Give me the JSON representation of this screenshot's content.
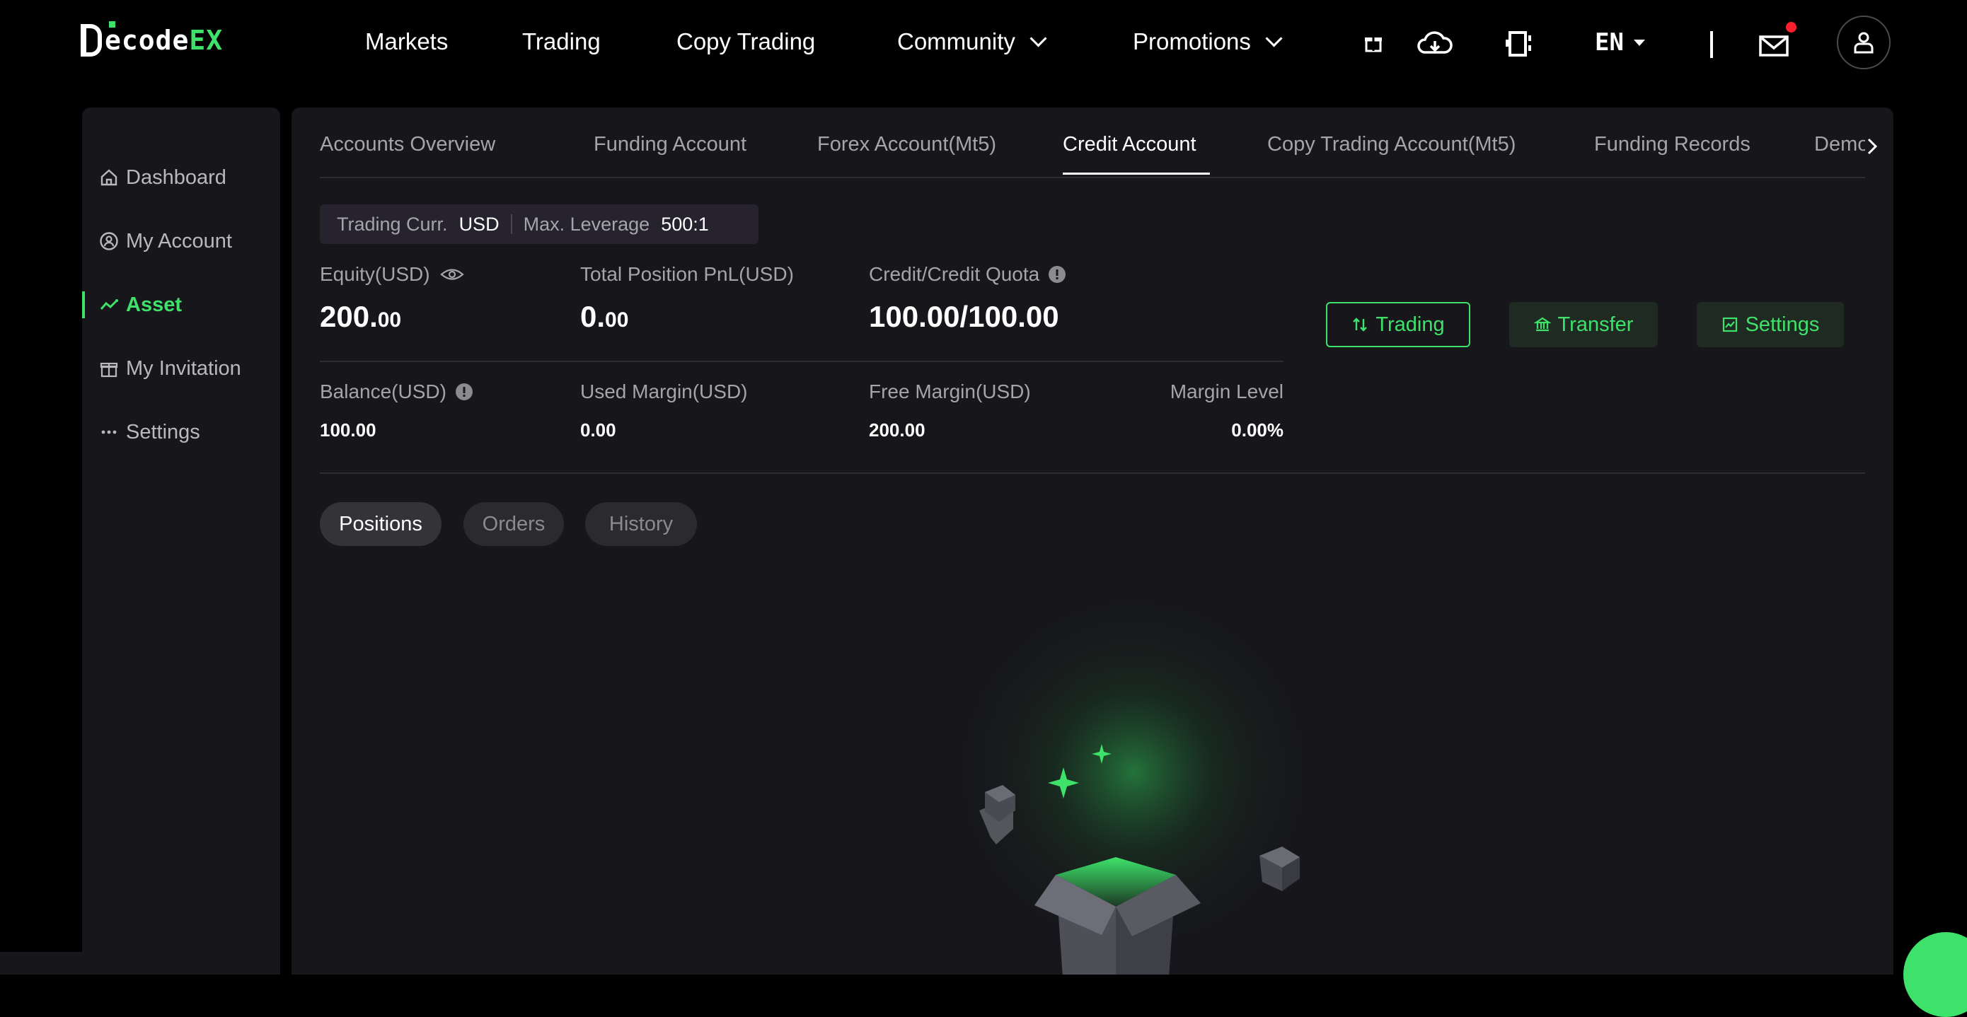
{
  "brand": {
    "logo_prefix": "ecode",
    "logo_suffix": "EX",
    "accent": "#3ee26a"
  },
  "nav": {
    "markets": "Markets",
    "trading": "Trading",
    "copy_trading": "Copy Trading",
    "community": "Community",
    "promotions": "Promotions",
    "language": "EN"
  },
  "sidebar": {
    "items": [
      {
        "label": "Dashboard",
        "icon": "home-icon"
      },
      {
        "label": "My Account",
        "icon": "user-circle-icon"
      },
      {
        "label": "Asset",
        "icon": "chart-line-icon",
        "active": true
      },
      {
        "label": "My Invitation",
        "icon": "gift-icon"
      },
      {
        "label": "Settings",
        "icon": "more-dots-icon"
      }
    ]
  },
  "tabs": [
    {
      "label": "Accounts Overview"
    },
    {
      "label": "Funding Account"
    },
    {
      "label": "Forex Account(Mt5)"
    },
    {
      "label": "Credit Account",
      "active": true
    },
    {
      "label": "Copy Trading Account(Mt5)"
    },
    {
      "label": "Funding Records"
    },
    {
      "label": "Demo"
    }
  ],
  "account_info": {
    "trading_curr_label": "Trading Curr.",
    "trading_curr_value": "USD",
    "max_leverage_label": "Max. Leverage",
    "max_leverage_value": "500:1"
  },
  "summary": {
    "equity_label": "Equity(USD)",
    "equity_int": "200.",
    "equity_dec": "00",
    "pnl_label": "Total Position PnL(USD)",
    "pnl_int": "0.",
    "pnl_dec": "00",
    "credit_label": "Credit/Credit Quota",
    "credit_value": "100.00/100.00",
    "balance_label": "Balance(USD)",
    "balance_value": "100.00",
    "used_margin_label": "Used Margin(USD)",
    "used_margin_value": "0.00",
    "free_margin_label": "Free Margin(USD)",
    "free_margin_value": "200.00",
    "margin_level_label": "Margin Level",
    "margin_level_value": "0.00%"
  },
  "actions": {
    "trading": "Trading",
    "transfer": "Transfer",
    "settings": "Settings"
  },
  "sub_tabs": [
    {
      "label": "Positions",
      "active": true
    },
    {
      "label": "Orders"
    },
    {
      "label": "History"
    }
  ]
}
